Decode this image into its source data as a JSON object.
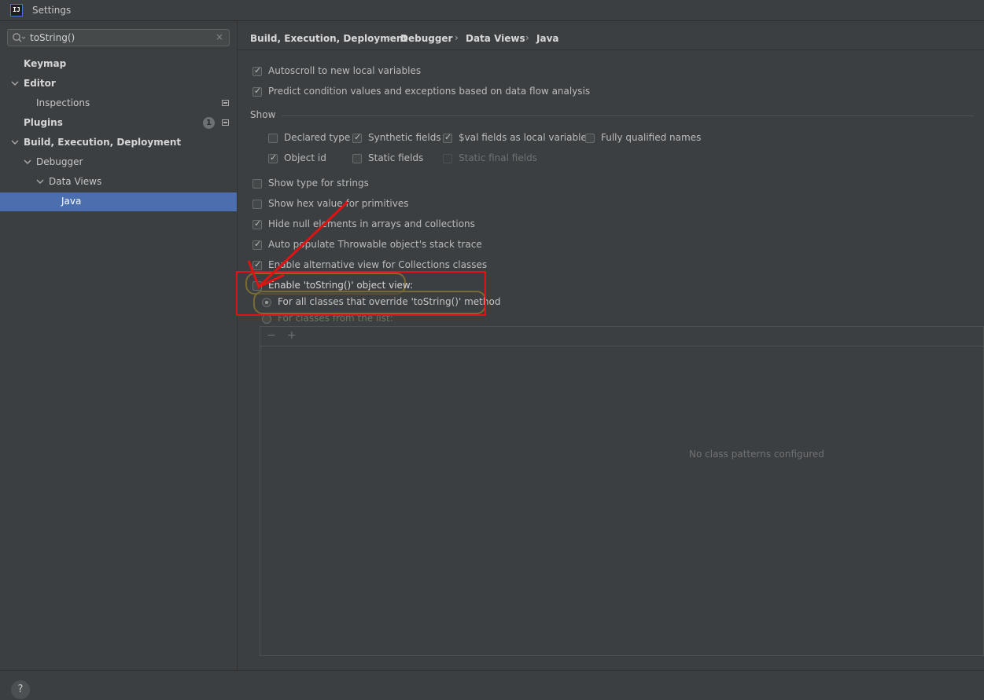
{
  "window": {
    "title": "Settings",
    "logo": "IJ"
  },
  "search": {
    "value": "toString()",
    "icon": "search-icon",
    "clear": "×"
  },
  "sidebar": {
    "items": [
      {
        "label": "Keymap"
      },
      {
        "label": "Editor"
      },
      {
        "label": "Inspections"
      },
      {
        "label": "Plugins",
        "badge": "1"
      },
      {
        "label": "Build, Execution, Deployment"
      },
      {
        "label": "Debugger"
      },
      {
        "label": "Data Views"
      },
      {
        "label": "Java"
      }
    ],
    "selected_color": "#4b6eaf"
  },
  "breadcrumb": {
    "items": [
      "Build, Execution, Deployment",
      "Debugger",
      "Data Views",
      "Java"
    ],
    "separator": "›"
  },
  "settings": {
    "autoscroll": {
      "label": "Autoscroll to new local variables",
      "checked": true
    },
    "predict": {
      "label": "Predict condition values and exceptions based on data flow analysis",
      "checked": true
    },
    "show_section": "Show",
    "show": {
      "declared_type": {
        "label": "Declared type",
        "checked": false
      },
      "synthetic_fields": {
        "label": "Synthetic fields",
        "checked": true
      },
      "val_fields": {
        "label": "$val fields as local variables",
        "checked": true
      },
      "fully_qualified": {
        "label": "Fully qualified names",
        "checked": false
      },
      "object_id": {
        "label": "Object id",
        "checked": true
      },
      "static_fields": {
        "label": "Static fields",
        "checked": false
      },
      "static_final_fields": {
        "label": "Static final fields",
        "checked": false,
        "disabled": true
      }
    },
    "show_type_strings": {
      "label": "Show type for strings",
      "checked": false
    },
    "show_hex": {
      "label": "Show hex value for primitives",
      "checked": false
    },
    "hide_null": {
      "label": "Hide null elements in arrays and collections",
      "checked": true
    },
    "auto_populate": {
      "label": "Auto populate Throwable object's stack trace",
      "checked": true
    },
    "alt_view": {
      "label": "Enable alternative view for Collections classes",
      "checked": true
    },
    "tostring_view": {
      "label": "Enable 'toString()' object view:",
      "checked": false
    },
    "radio_all": {
      "label": "For all classes that override 'toString()' method",
      "selected": true
    },
    "radio_list": {
      "label": "For classes from the list:",
      "selected": false
    },
    "table": {
      "remove": "−",
      "add": "+",
      "empty_text": "No class patterns configured"
    }
  },
  "colors": {
    "annotation": "#e01212",
    "highlight": "#7a6a33"
  },
  "help": {
    "label": "?"
  }
}
